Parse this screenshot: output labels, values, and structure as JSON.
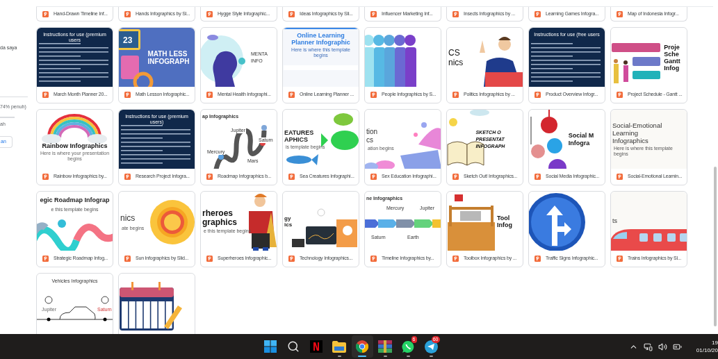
{
  "sidebar": {
    "label": "da saya",
    "storage": "74% penuh)",
    "storage_link": "ah",
    "button": "an"
  },
  "top_row": [
    "Hand-Drawn Timeline Inf...",
    "Hands Infographics by Sl...",
    "Hygge Style Infographic...",
    "Ideas Infographics by Sli...",
    "Influencer Marketing Inf...",
    "Insects Infographics by ...",
    "Learning Games Infogra...",
    "Map of Indonesia Infogr..."
  ],
  "files": [
    {
      "name": "March Month Planner 20...",
      "thumb": {
        "kind": "instructions",
        "title": [
          "Instructions for use (premium users"
        ]
      }
    },
    {
      "name": "Math Lesson Infographic...",
      "thumb": {
        "kind": "math",
        "title": [
          "MATH LESS",
          "INFOGRAPH"
        ],
        "labels": [
          "23"
        ]
      }
    },
    {
      "name": "Mental Health Infographi...",
      "thumb": {
        "kind": "mental",
        "title": [
          "MENTA",
          "INFO"
        ]
      }
    },
    {
      "name": "Online Learning Planner ...",
      "thumb": {
        "kind": "online",
        "title": [
          "Online Learning",
          "Planner Infographic"
        ],
        "subtitle": "Here is where this template begins"
      }
    },
    {
      "name": "People Infographics by S...",
      "thumb": {
        "kind": "people"
      }
    },
    {
      "name": "Politics Infographics by ...",
      "thumb": {
        "kind": "politics",
        "title": [
          "CS",
          "nics"
        ]
      }
    },
    {
      "name": "Product Overview Infogr...",
      "thumb": {
        "kind": "instructions",
        "title": [
          "Instructions for use (free users"
        ]
      }
    },
    {
      "name": "Project Schedule - Gantt ...",
      "thumb": {
        "kind": "gantt",
        "title": [
          "Proje",
          "Sche",
          "Gantt",
          "Infog"
        ]
      }
    },
    {
      "name": "Rainbow Infographics by...",
      "thumb": {
        "kind": "rainbow",
        "title": [
          "Rainbow Infographics"
        ],
        "subtitle": "Here is where your presentation begins"
      }
    },
    {
      "name": "Research Project Infogra...",
      "thumb": {
        "kind": "instructions",
        "title": [
          "Instructions for use (premium users)"
        ]
      }
    },
    {
      "name": "Roadmap Infographics b...",
      "thumb": {
        "kind": "road",
        "title": [
          "ap Infographics"
        ],
        "labels": [
          "Jupiter",
          "Mercury",
          "Saturn",
          "Mars"
        ]
      }
    },
    {
      "name": "Sea Creatures Infographi...",
      "thumb": {
        "kind": "fish",
        "title": [
          "EATURES",
          "APHICS"
        ],
        "subtitle": "is template begins"
      }
    },
    {
      "name": "Sex Education Infographi...",
      "thumb": {
        "kind": "hearts",
        "title": [
          "tion",
          "cs"
        ],
        "subtitle": "ation begins"
      }
    },
    {
      "name": "Sketch Out! Infographics...",
      "thumb": {
        "kind": "sketch",
        "title": [
          "SKETCH O",
          "PRESENTAT",
          "INFOGRAPH"
        ]
      }
    },
    {
      "name": "Social Media Infographic...",
      "thumb": {
        "kind": "social",
        "title": [
          "Social M",
          "Infogra"
        ]
      }
    },
    {
      "name": "Social-Emotional Learnin...",
      "thumb": {
        "kind": "plain",
        "title": [
          "Social-Emotional",
          "Learning",
          "Infographics"
        ],
        "subtitle": "Here is where this template begins"
      }
    },
    {
      "name": "Strategic Roadmap Infog...",
      "thumb": {
        "kind": "wave",
        "title": [
          "egic Roadmap Infograp"
        ],
        "subtitle": "e this template begins"
      }
    },
    {
      "name": "Sun Infographics by Slid...",
      "thumb": {
        "kind": "sun",
        "title": [
          "nics"
        ],
        "subtitle": "ate begins"
      }
    },
    {
      "name": "Superheroes Infographic...",
      "thumb": {
        "kind": "hero",
        "title": [
          "rheroes",
          "graphics"
        ],
        "subtitle": "e this template begins"
      }
    },
    {
      "name": "Technology Infographics...",
      "thumb": {
        "kind": "tech",
        "title": [
          "gy",
          "ics"
        ]
      }
    },
    {
      "name": "Timeline Infographics by...",
      "thumb": {
        "kind": "timeline",
        "title": [
          "ne Infographics"
        ],
        "labels": [
          "Mercury",
          "Jupiter",
          "Saturn",
          "Earth"
        ]
      }
    },
    {
      "name": "Toolbox Infographics by ...",
      "thumb": {
        "kind": "toolbox",
        "title": [
          "Tool",
          "Infog"
        ]
      }
    },
    {
      "name": "Traffic Signs Infographic...",
      "thumb": {
        "kind": "sign"
      }
    },
    {
      "name": "Trains Infographics by Sl...",
      "thumb": {
        "kind": "train",
        "title": [
          "ts"
        ]
      }
    },
    {
      "thumb": {
        "kind": "car",
        "title": [
          "Vehicles Infographics"
        ],
        "labels": [
          "Jupiter",
          "Saturn"
        ]
      }
    },
    {
      "thumb": {
        "kind": "calendar"
      }
    }
  ],
  "taskbar": [
    {
      "kind": "start",
      "running": false,
      "selected": false
    },
    {
      "kind": "search",
      "running": false,
      "selected": false
    },
    {
      "kind": "netflix",
      "running": false,
      "selected": false
    },
    {
      "kind": "files",
      "running": true,
      "selected": false
    },
    {
      "kind": "chrome",
      "running": true,
      "selected": true
    },
    {
      "kind": "winrar",
      "running": true,
      "selected": false
    },
    {
      "kind": "whatsapp",
      "running": true,
      "selected": false,
      "badge": "6"
    },
    {
      "kind": "telegram",
      "running": true,
      "selected": false,
      "badge": "60"
    }
  ],
  "clock": {
    "time": "19",
    "date": "01/10/20"
  }
}
